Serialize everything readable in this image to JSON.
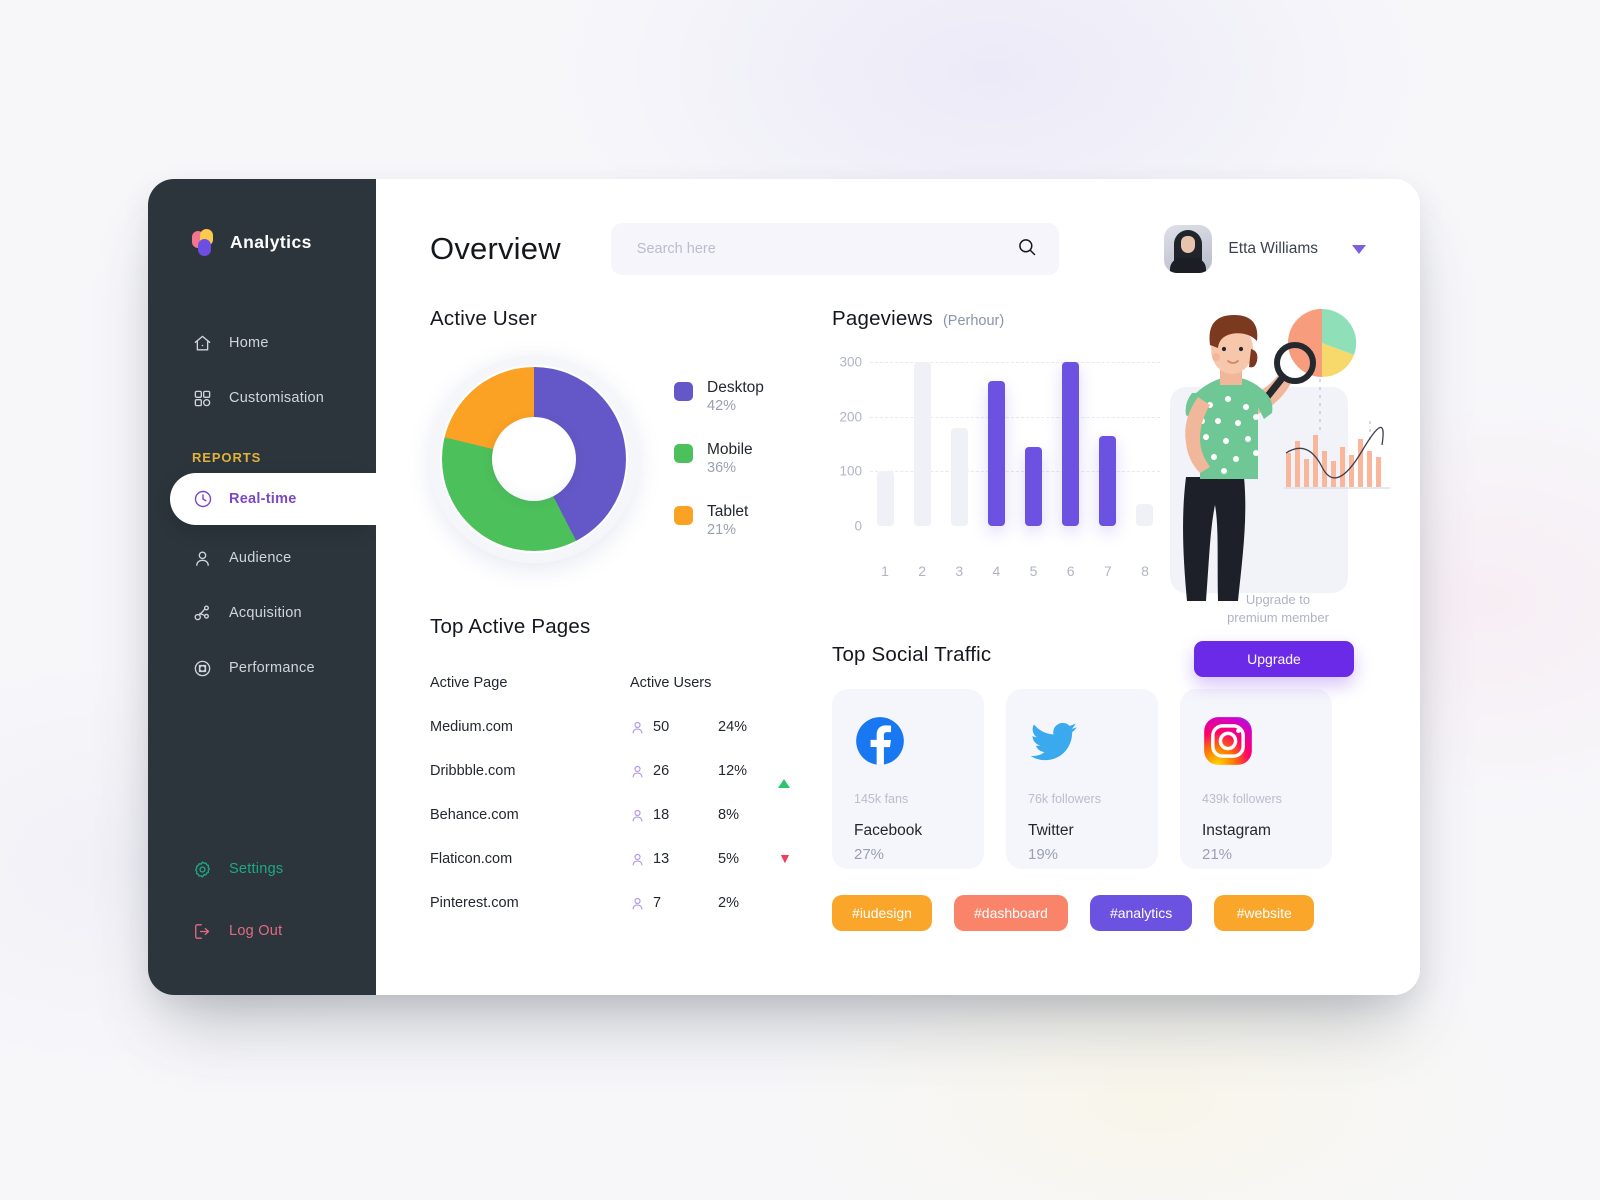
{
  "sidebar": {
    "brand": "Analytics",
    "items": [
      {
        "label": "Home",
        "icon": "home-icon"
      },
      {
        "label": "Customisation",
        "icon": "grid-icon"
      }
    ],
    "section_label": "REPORTS",
    "report_items": [
      {
        "label": "Real-time",
        "icon": "clock-icon",
        "active": true
      },
      {
        "label": "Audience",
        "icon": "user-icon",
        "active": false
      },
      {
        "label": "Acquisition",
        "icon": "share-icon",
        "active": false
      },
      {
        "label": "Performance",
        "icon": "target-icon",
        "active": false
      }
    ],
    "settings_label": "Settings",
    "logout_label": "Log Out"
  },
  "header": {
    "page_title": "Overview",
    "search_placeholder": "Search here",
    "search_value": "",
    "user_name": "Etta Williams"
  },
  "active_user": {
    "title": "Active User"
  },
  "pageviews": {
    "title": "Pageviews",
    "subtitle": "(Perhour)"
  },
  "promo": {
    "line1": "Upgrade to",
    "line2": "premium member",
    "button": "Upgrade"
  },
  "top_pages": {
    "title": "Top Active Pages",
    "columns": [
      "Active Page",
      "Active Users"
    ],
    "rows": [
      {
        "page": "Medium.com",
        "users": "50",
        "pct": "24%",
        "trend": "none"
      },
      {
        "page": "Dribbble.com",
        "users": "26",
        "pct": "12%",
        "trend": "up"
      },
      {
        "page": "Behance.com",
        "users": "18",
        "pct": "8%",
        "trend": "none"
      },
      {
        "page": "Flaticon.com",
        "users": "13",
        "pct": "5%",
        "trend": "down"
      },
      {
        "page": "Pinterest.com",
        "users": "7",
        "pct": "2%",
        "trend": "none"
      }
    ]
  },
  "social": {
    "title": "Top Social Traffic",
    "cards": [
      {
        "name": "Facebook",
        "followers": "145k fans",
        "pct": "27%",
        "icon": "facebook-icon"
      },
      {
        "name": "Twitter",
        "followers": "76k followers",
        "pct": "19%",
        "icon": "twitter-icon"
      },
      {
        "name": "Instagram",
        "followers": "439k followers",
        "pct": "21%",
        "icon": "instagram-icon"
      }
    ],
    "tags": [
      {
        "label": "#iudesign",
        "color": "#f9a62b"
      },
      {
        "label": "#dashboard",
        "color": "#f98469"
      },
      {
        "label": "#analytics",
        "color": "#6b52e0"
      },
      {
        "label": "#website",
        "color": "#f9a62b"
      }
    ]
  },
  "colors": {
    "accent_purple": "#6b52e0",
    "desktop": "#6457c7",
    "mobile": "#4cc05a",
    "tablet": "#fba124",
    "sidebar_bg": "#2b353b",
    "reports_label": "#e0b23c",
    "settings": "#1fa884",
    "logout": "#e36a85",
    "trend_up": "#2ec46b",
    "trend_down": "#ef3d5e"
  },
  "chart_data": [
    {
      "type": "pie",
      "title": "Active User",
      "labels": [
        "Desktop",
        "Mobile",
        "Tablet"
      ],
      "values": [
        42,
        36,
        21
      ],
      "value_labels": [
        "42%",
        "36%",
        "21%"
      ],
      "colors": [
        "#6457c7",
        "#4cc05a",
        "#fba124"
      ],
      "donut": true,
      "legend": "right"
    },
    {
      "type": "bar",
      "title": "Pageviews",
      "subtitle": "(Perhour)",
      "categories": [
        "1",
        "2",
        "3",
        "4",
        "5",
        "6",
        "7",
        "8"
      ],
      "values": [
        100,
        300,
        180,
        265,
        145,
        300,
        165,
        40
      ],
      "highlighted": [
        false,
        false,
        false,
        true,
        true,
        true,
        true,
        false
      ],
      "xlabel": "",
      "ylabel": "",
      "ylim": [
        0,
        320
      ],
      "yticks": [
        0,
        100,
        200,
        300
      ],
      "grid": true,
      "legend": "none",
      "bar_color": "#6b52e0",
      "bar_color_muted": "#f0f1f6"
    }
  ]
}
